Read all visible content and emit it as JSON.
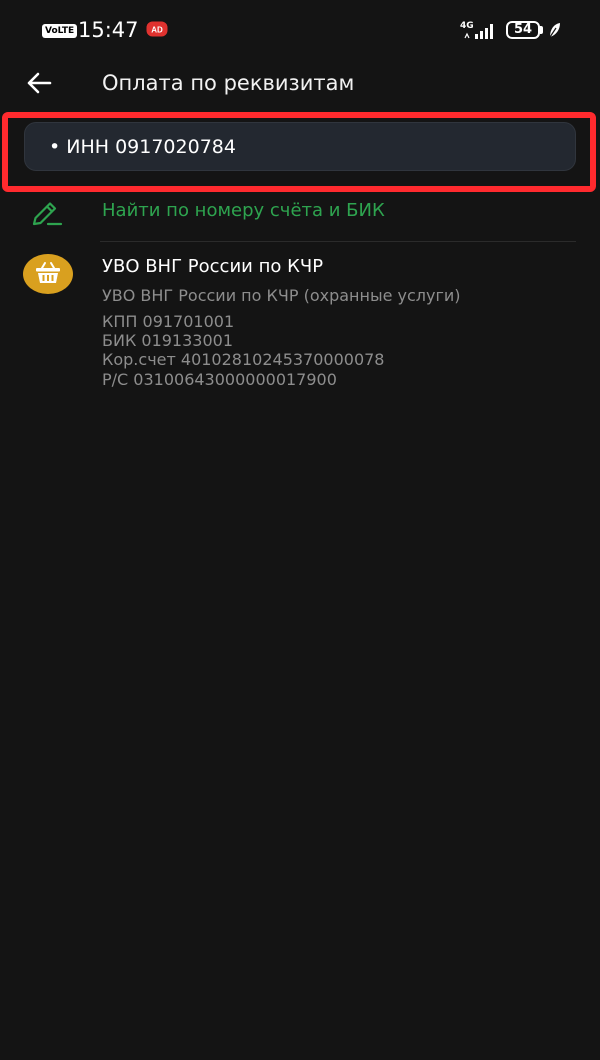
{
  "status_bar": {
    "volte": "VoLTE",
    "time": "15:47",
    "ad_badge": "AD",
    "network": "4G",
    "battery": "54"
  },
  "header": {
    "title": "Оплата по реквизитам"
  },
  "search": {
    "value": "• ИНН 0917020784"
  },
  "find_by_account": {
    "label": "Найти по номеру счёта и БИК"
  },
  "colors": {
    "accent_green": "#2ea44f",
    "highlight_red": "#ff2a2e",
    "avatar_yellow": "#d9a01f"
  },
  "results": [
    {
      "icon": "basket-icon",
      "title": "УВО ВНГ России по КЧР",
      "subtitle": "УВО ВНГ России по КЧР (охранные услуги)",
      "kpp": "КПП 091701001",
      "bik": "БИК 019133001",
      "kor_schet": "Кор.счет 40102810245370000078",
      "rs": "Р/С 03100643000000017900"
    }
  ]
}
